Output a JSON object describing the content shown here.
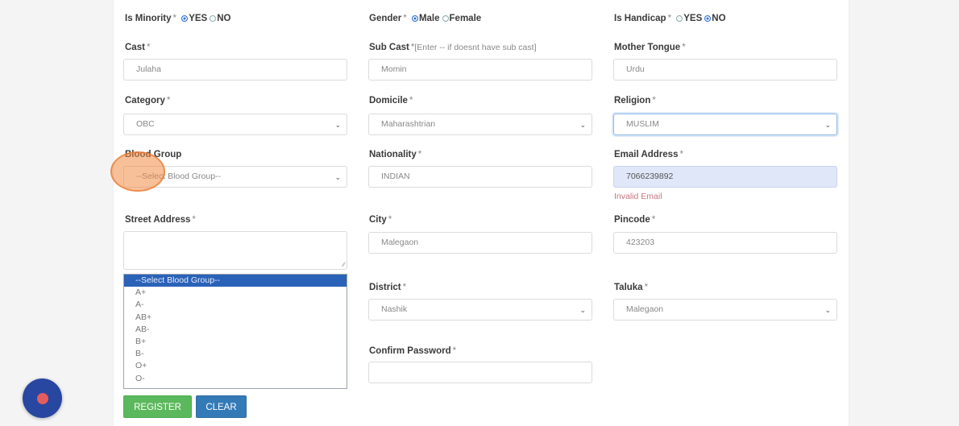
{
  "row0": {
    "minority": {
      "label": "Is Minority",
      "req": "*",
      "opt1": "YES",
      "opt2": "NO"
    },
    "gender": {
      "label": "Gender",
      "req": "*",
      "opt1": "Male",
      "opt2": "Female"
    },
    "handicap": {
      "label": "Is Handicap",
      "req": "*",
      "opt1": "YES",
      "opt2": "NO"
    }
  },
  "cast": {
    "label": "Cast",
    "req": "*",
    "value": "Julaha"
  },
  "subcast": {
    "label": "Sub Cast",
    "req": "*",
    "hint": "[Enter -- if doesnt have sub cast]",
    "value": "Momin"
  },
  "tongue": {
    "label": "Mother Tongue",
    "req": "*",
    "value": "Urdu"
  },
  "category": {
    "label": "Category",
    "req": "*",
    "value": "OBC"
  },
  "domicile": {
    "label": "Domicile",
    "req": "*",
    "value": "Maharashtrian"
  },
  "religion": {
    "label": "Religion",
    "req": "*",
    "value": "MUSLIM"
  },
  "blood": {
    "label": "Blood Group",
    "value": "--Select Blood Group--",
    "options": [
      "--Select Blood Group--",
      "A+",
      "A-",
      "AB+",
      "AB-",
      "B+",
      "B-",
      "O+",
      "O-"
    ]
  },
  "nationality": {
    "label": "Nationality",
    "req": "*",
    "value": "INDIAN"
  },
  "email": {
    "label": "Email Address",
    "req": "*",
    "value": "7066239892",
    "error": "Invalid Email"
  },
  "street": {
    "label": "Street Address",
    "req": "*"
  },
  "city": {
    "label": "City",
    "req": "*",
    "value": "Malegaon"
  },
  "pincode": {
    "label": "Pincode",
    "req": "*",
    "value": "423203"
  },
  "district": {
    "label": "District",
    "req": "*",
    "value": "Nashik"
  },
  "taluka": {
    "label": "Taluka",
    "req": "*",
    "value": "Malegaon"
  },
  "confirm": {
    "label": "Confirm Password",
    "req": "*"
  },
  "buttons": {
    "register": "REGISTER",
    "clear": "CLEAR"
  },
  "colors": {
    "register": "#5cb85c",
    "clear": "#337ab7",
    "error": "#c9757c",
    "highlight": "#2a62b8"
  },
  "icons": {
    "chevron": "chevron-down-icon",
    "record": "record-icon"
  }
}
